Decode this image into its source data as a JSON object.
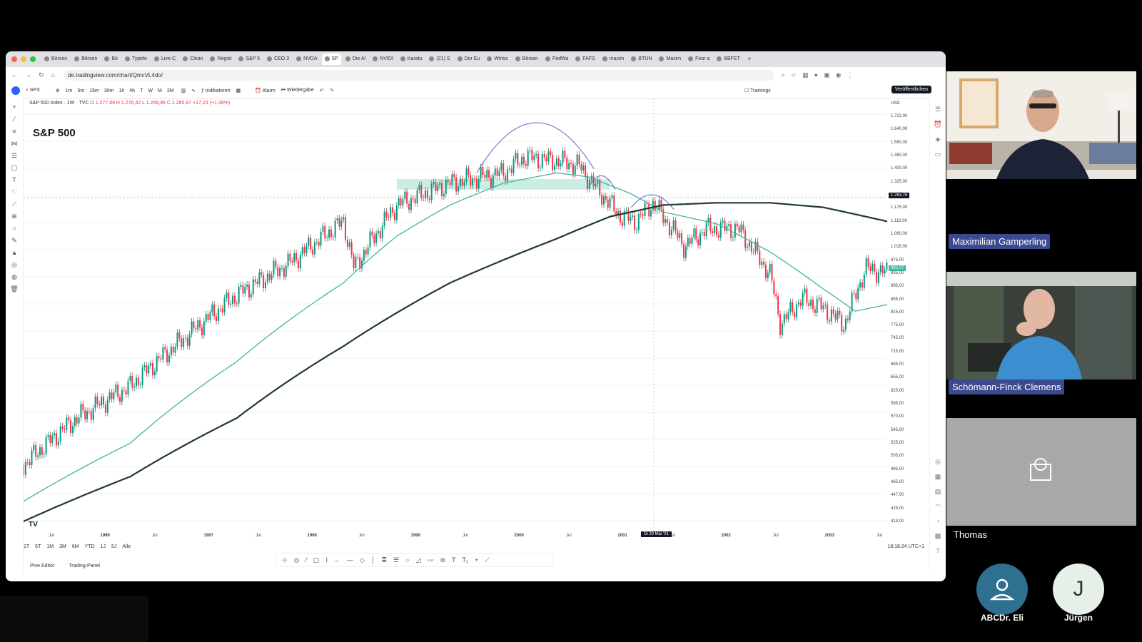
{
  "browser": {
    "tabs": [
      "Börsen",
      "Börsen",
      "Bö",
      "Typefo",
      "Live-C",
      "Clean",
      "Regist",
      "S&P 5",
      "CEO 3",
      "NVDA",
      "SP",
      "Die Al",
      "NVIDI",
      "Karatu",
      "(21) S",
      "Der Eu",
      "Wirtsc",
      "Börsen",
      "FedWa",
      "FAFS",
      "maxim",
      "BTUN",
      "Maxim",
      "Fear a",
      "BBFET"
    ],
    "active_tab_index": 10,
    "url": "de.tradingview.com/chart/QmcVL4do/"
  },
  "tv_toolbar": {
    "symbol": "SPX",
    "timeframes": [
      "1m",
      "5m",
      "15m",
      "30m",
      "1h",
      "4h",
      "T",
      "W",
      "M",
      "3M"
    ],
    "indicators_label": "Indikatoren",
    "alarm_label": "Alarm",
    "replay_label": "Wiedergabe",
    "trainings_label": "Trainings",
    "publish_label": "Veröffentlichen"
  },
  "legend": {
    "title": "S&P 500 Index · 1W · TVC",
    "ohlc": "O 1.277,89  H 1.276,42  L 1.249,96  C 1.260,87  +17,23 (+1,39%)"
  },
  "chart_title": "S&P 500",
  "chart_data": {
    "type": "line",
    "title": "S&P 500",
    "x_range": [
      1995.5,
      2003.6
    ],
    "ylim": [
      413,
      1722
    ],
    "y_axis_label": "USD",
    "last_price": "1.283,76",
    "price_label_secondary": "992,07",
    "series": [
      {
        "x": [
          1995.5,
          1996.0,
          1996.5,
          1997.0,
          1997.5,
          1998.0,
          1998.5,
          1998.6,
          1999.0,
          1999.5,
          2000.0,
          2000.2,
          2000.5,
          2000.7,
          2000.9,
          2001.1,
          2001.25,
          2001.4,
          2001.7,
          2001.9,
          2002.2,
          2002.5,
          2002.6,
          2002.8,
          2003.0,
          2003.2,
          2003.4,
          2003.6
        ],
        "y": [
          500,
          590,
          660,
          780,
          910,
          1020,
          1180,
          1000,
          1250,
          1350,
          1400,
          1480,
          1460,
          1440,
          1310,
          1200,
          1180,
          1260,
          1080,
          1150,
          1150,
          980,
          820,
          900,
          870,
          820,
          1000,
          985
        ]
      },
      {
        "x": [
          1995.5,
          1996.5,
          1997.5,
          1998.5,
          1999.0,
          1999.5,
          2000.0,
          2000.5,
          2000.8,
          2001.2,
          2001.5,
          2002.0,
          2002.5,
          2003.0,
          2003.3,
          2003.6
        ],
        "y": [
          440,
          540,
          720,
          950,
          1120,
          1250,
          1350,
          1400,
          1380,
          1300,
          1220,
          1170,
          1060,
          930,
          860,
          880
        ]
      },
      {
        "x": [
          1995.5,
          1996.5,
          1997.5,
          1998.5,
          1999.5,
          2000.5,
          2001.0,
          2001.5,
          2002.0,
          2002.5,
          2003.0,
          2003.6
        ],
        "y": [
          410,
          480,
          590,
          760,
          950,
          1110,
          1200,
          1250,
          1260,
          1260,
          1240,
          1180
        ]
      }
    ],
    "x_ticks": [
      "Jul",
      "1996",
      "Jul",
      "1997",
      "Jul",
      "1998",
      "Jul",
      "1999",
      "Jul",
      "2000",
      "Jul",
      "2001",
      "Jul",
      "2002",
      "Jul",
      "2003",
      "Jul"
    ],
    "y_ticks": [
      "1.722,00",
      "1.640,00",
      "1.560,00",
      "1.480,00",
      "1.400,00",
      "1.325,00",
      "1.225,00",
      "1.175,00",
      "1.115,00",
      "1.060,00",
      "1.015,00",
      "975,00",
      "935,00",
      "895,00",
      "855,00",
      "815,00",
      "775,00",
      "745,00",
      "715,00",
      "685,00",
      "655,00",
      "625,00",
      "595,00",
      "570,00",
      "545,00",
      "525,00",
      "505,00",
      "485,00",
      "465,00",
      "447,00",
      "429,00",
      "413,00"
    ],
    "cursor_date": "Di 29 Mai '01",
    "series_colors": {
      "price_up": "#089981",
      "price_down": "#f23645",
      "ma_fast": "#3fb59c",
      "ma_slow": "#1f3a2c",
      "annotation": "#5468c4",
      "zone": "#a6e3d2"
    }
  },
  "bottom_bar": {
    "ranges": [
      "1T",
      "5T",
      "1M",
      "3M",
      "6M",
      "YTD",
      "1J",
      "5J",
      "Alle"
    ],
    "time": "18:18:24 UTC+1",
    "tabs": [
      "Pine Editor",
      "Trading-Panel"
    ]
  },
  "participants": [
    {
      "name": "Maximilian Gamperling",
      "type": "video"
    },
    {
      "name": "Schömann-Finck Clemens",
      "type": "video"
    },
    {
      "name": "Thomas",
      "type": "placeholder"
    },
    {
      "name": "ABCDr. Eli",
      "type": "avatar"
    },
    {
      "name": "Jürgen",
      "type": "avatar",
      "initial": "J"
    }
  ]
}
